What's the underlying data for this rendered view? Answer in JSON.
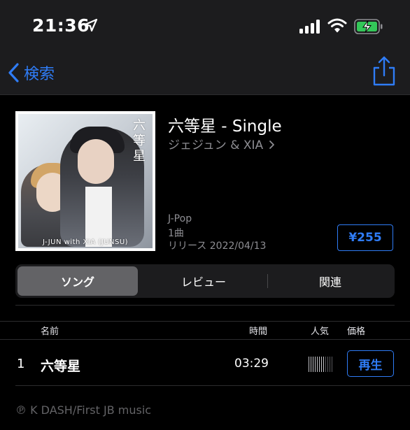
{
  "status_bar": {
    "time": "21:36",
    "icons": [
      "location-arrow-icon",
      "cellular-signal-icon",
      "wifi-icon",
      "battery-charging-icon"
    ],
    "battery_color": "#34c759"
  },
  "nav": {
    "back_label": "検索",
    "icons": [
      "chevron-left-icon",
      "share-icon"
    ],
    "accent_color": "#2f7cf6"
  },
  "album": {
    "artwork_title": "六等星",
    "artwork_credit": "J-JUN with XIA (JUNSU)",
    "title": "六等星 - Single",
    "artist": "ジェジュン & XIA",
    "genre": "J-Pop",
    "track_count": "1曲",
    "release": "リリース 2022/04/13",
    "price": "¥255"
  },
  "tabs": [
    {
      "label": "ソング",
      "selected": true
    },
    {
      "label": "レビュー",
      "selected": false
    },
    {
      "label": "関連",
      "selected": false
    }
  ],
  "table": {
    "headers": {
      "name": "名前",
      "time": "時間",
      "popularity": "人気",
      "price": "価格"
    },
    "rows": [
      {
        "number": "1",
        "name": "六等星",
        "time": "03:29",
        "popularity": 0.6,
        "action": "再生"
      }
    ]
  },
  "footer": {
    "copyright": "℗ K DASH/First JB music"
  }
}
